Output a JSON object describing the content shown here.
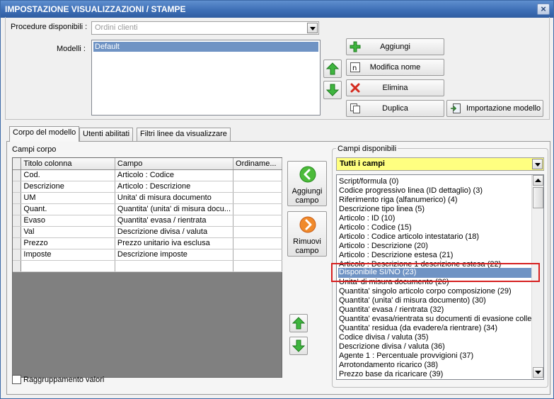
{
  "window": {
    "title": "IMPOSTAZIONE VISUALIZZAZIONI / STAMPE",
    "close": "×"
  },
  "procedure": {
    "label": "Procedure disponibili :",
    "value": "Ordini clienti"
  },
  "modelli": {
    "label": "Modelli :",
    "items": [
      "Default"
    ]
  },
  "buttons": {
    "aggiungi": "Aggiungi",
    "modifica": "Modifica nome",
    "elimina": "Elimina",
    "duplica": "Duplica",
    "importazione": "Importazione modello"
  },
  "tabs": [
    "Corpo del modello",
    "Utenti abilitati",
    "Filtri linee da visualizzare"
  ],
  "campi_corpo": {
    "label": "Campi corpo",
    "columns": [
      "Titolo colonna",
      "Campo",
      "Ordiname..."
    ],
    "rows": [
      [
        "Cod.",
        "Articolo : Codice"
      ],
      [
        "Descrizione",
        "Articolo : Descrizione"
      ],
      [
        "UM",
        "Unita' di misura documento"
      ],
      [
        "Quant.",
        "Quantita' (unita' di misura docu..."
      ],
      [
        "Evaso",
        "Quantita' evasa / rientrata"
      ],
      [
        "Val",
        "Descrizione divisa / valuta"
      ],
      [
        "Prezzo",
        "Prezzo unitario iva esclusa"
      ],
      [
        "Imposte",
        "Descrizione imposte"
      ]
    ]
  },
  "aggiungi_campo": "Aggiungi campo",
  "rimuovi_campo": "Rimuovi campo",
  "raggruppamento": "Raggruppamento valori",
  "campi_disponibili": {
    "label": "Campi disponibili",
    "filter": "Tutti i campi",
    "items": [
      "Script/formula (0)",
      "Codice progressivo linea (ID dettaglio) (3)",
      "Riferimento riga (alfanumerico) (4)",
      "Descrizione tipo linea (5)",
      "Articolo : ID (10)",
      "Articolo : Codice (15)",
      "Articolo : Codice articolo intestatario (18)",
      "Articolo : Descrizione (20)",
      "Articolo : Descrizione estesa (21)",
      "Articolo : Descrizione 1 descrizione estesa (22)",
      "Disponibile SI/NO (23)",
      "Unita' di misura documento (26)",
      "Quantita' singolo articolo corpo composizione (29)",
      "Quantita' (unita' di misura documento) (30)",
      "Quantita' evasa / rientrata (32)",
      "Quantita' evasa/rientrata su documenti di evasione collegati",
      "Quantita' residua (da evadere/a rientrare) (34)",
      "Codice divisa / valuta (35)",
      "Descrizione divisa / valuta (36)",
      "Agente 1 : Percentuale provvigioni (37)",
      "Arrotondamento ricarico (38)",
      "Prezzo base da ricaricare (39)"
    ]
  }
}
